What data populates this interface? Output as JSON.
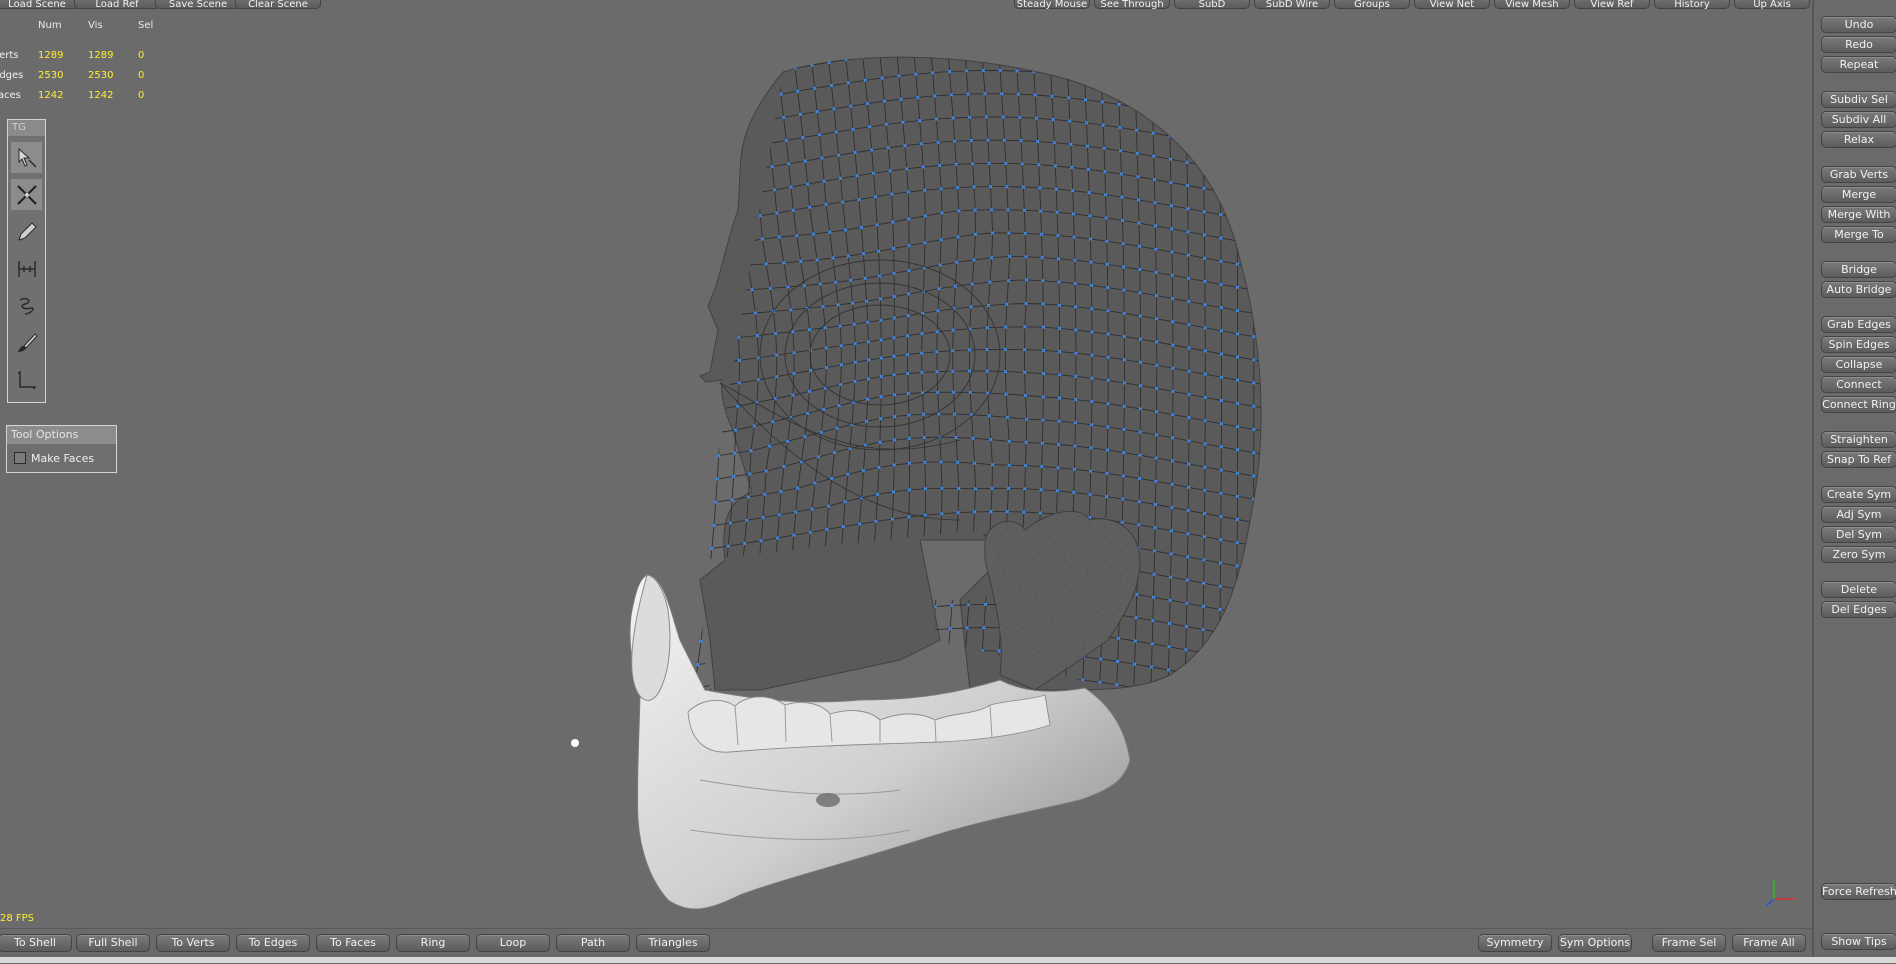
{
  "top_toolbar": {
    "left": [
      "Load Scene",
      "Load Ref",
      "Save Scene",
      "Clear Scene"
    ],
    "right": [
      "Steady Mouse",
      "See Through",
      "SubD",
      "SubD Wire",
      "Groups",
      "View Net",
      "View Mesh",
      "View Ref",
      "History",
      "Up Axis"
    ]
  },
  "stats": {
    "headers": [
      "Num",
      "Vis",
      "Sel"
    ],
    "rows": [
      {
        "label": "Verts",
        "num": "1289",
        "vis": "1289",
        "sel": "0"
      },
      {
        "label": "Edges",
        "num": "2530",
        "vis": "2530",
        "sel": "0"
      },
      {
        "label": "Faces",
        "num": "1242",
        "vis": "1242",
        "sel": "0"
      }
    ]
  },
  "tool_palette": {
    "title": "TG",
    "tools": [
      "select-arrow-icon",
      "cut-cross-icon",
      "pencil-icon",
      "bridge-icon",
      "relax-brush-icon",
      "brush-icon",
      "frame-icon"
    ]
  },
  "tool_options": {
    "title": "Tool Options",
    "make_faces": "Make Faces"
  },
  "right_panel": {
    "buttons": [
      "Undo",
      "Redo",
      "Repeat",
      "Subdiv Sel",
      "Subdiv All",
      "Relax",
      "Grab Verts",
      "Merge",
      "Merge With",
      "Merge To",
      "Bridge",
      "Auto Bridge",
      "Grab Edges",
      "Spin Edges",
      "Collapse",
      "Connect",
      "Connect Ring",
      "Straighten",
      "Snap To Ref",
      "Create Sym",
      "Adj Sym",
      "Del Sym",
      "Zero Sym",
      "Delete",
      "Del Edges"
    ],
    "force_refresh": "Force Refresh",
    "show_tips": "Show Tips"
  },
  "bottom_bar": {
    "left": [
      "To Shell",
      "Full Shell",
      "To Verts",
      "To Edges",
      "To Faces",
      "Ring",
      "Loop",
      "Path",
      "Triangles"
    ],
    "right": [
      "Symmetry",
      "Sym Options",
      "Frame Sel",
      "Frame All"
    ]
  },
  "fps": "28 FPS",
  "colors": {
    "background": "#6b6b6b",
    "wire_vertex": "#3a86e6",
    "stat_value": "#ffee33"
  }
}
